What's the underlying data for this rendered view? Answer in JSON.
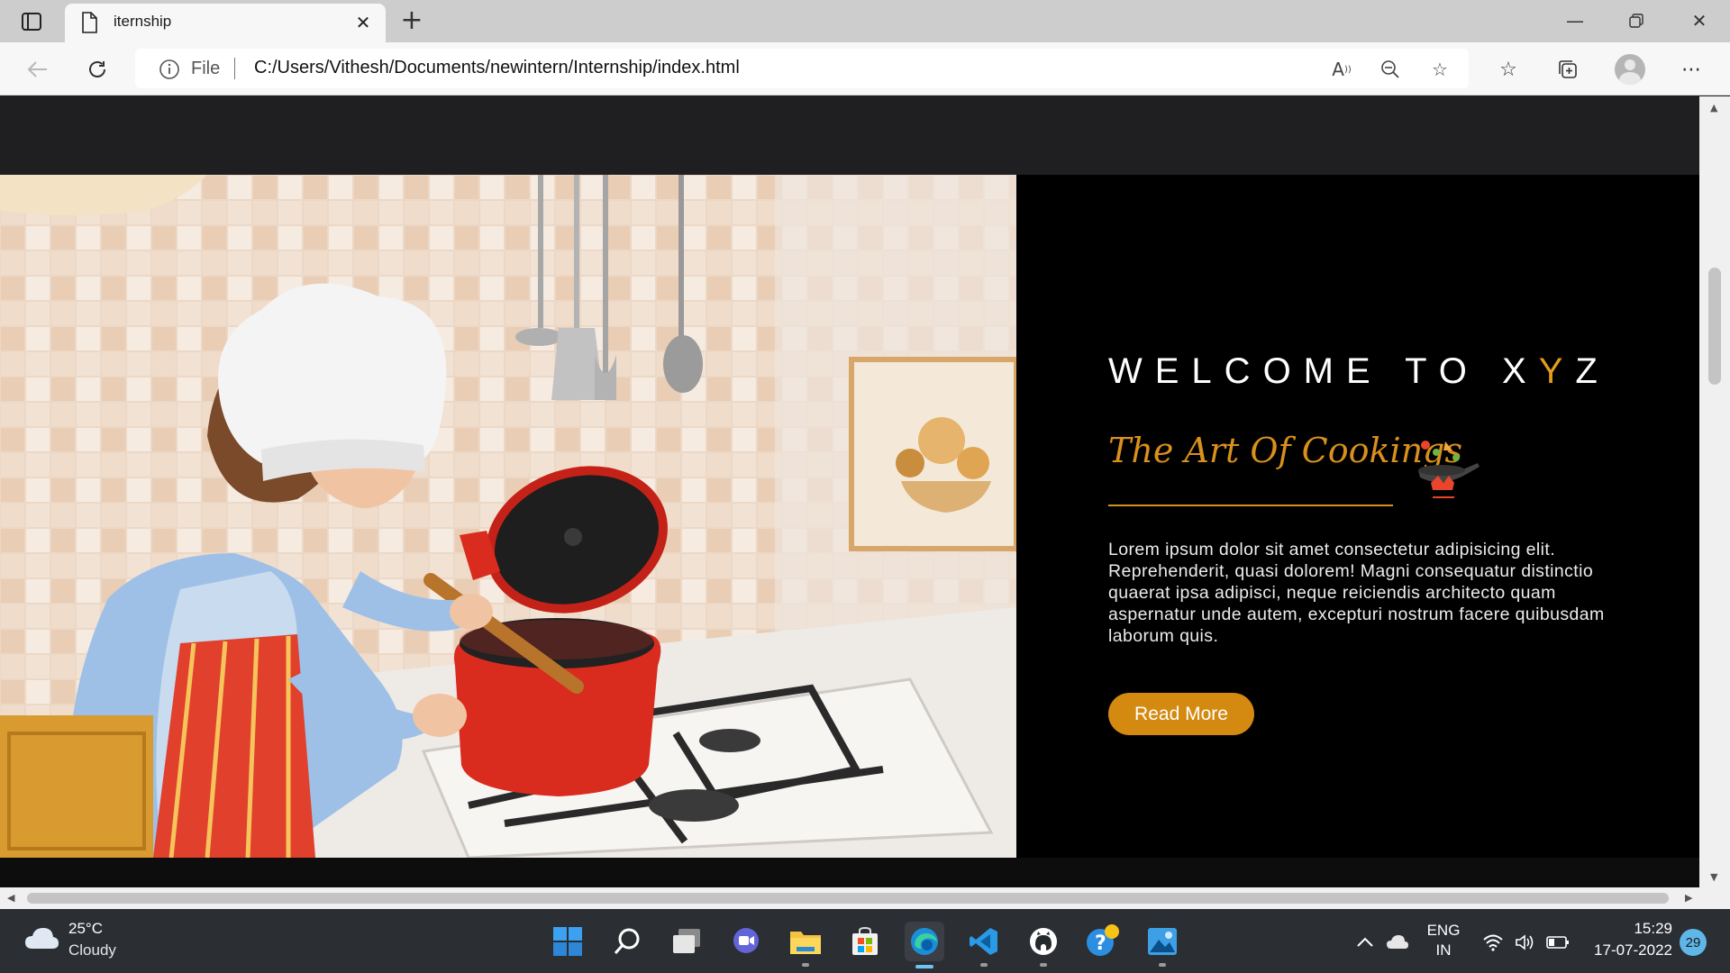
{
  "browser": {
    "tab": {
      "title": "iternship"
    },
    "address": {
      "scheme_label": "File",
      "url": "C:/Users/Vithesh/Documents/newintern/Internship/index.html"
    }
  },
  "page": {
    "hero": {
      "welcome_prefix": "WELCOME TO X",
      "welcome_accent": "Y",
      "welcome_suffix": "Z",
      "tagline": "The Art Of Cookings",
      "description": "Lorem ipsum dolor sit amet consectetur adipisicing elit. Reprehenderit, quasi dolorem! Magni consequatur distinctio quaerat ipsa adipisci, neque reiciendis architecto quam aspernatur unde autem, excepturi nostrum facere quibusdam laborum quis.",
      "button_label": "Read More",
      "accent_color": "#d48a10",
      "image_alt": "chef cooking image"
    }
  },
  "taskbar": {
    "weather": {
      "temp": "25°C",
      "condition": "Cloudy"
    },
    "language": {
      "line1": "ENG",
      "line2": "IN"
    },
    "clock": {
      "time": "15:29",
      "date": "17-07-2022"
    },
    "notifications": "29",
    "apps": [
      "start-icon",
      "search-icon",
      "task-view-icon",
      "teams-chat-icon",
      "file-explorer-icon",
      "store-icon",
      "edge-icon",
      "vscode-icon",
      "github-icon",
      "tips-icon",
      "photos-icon"
    ]
  }
}
